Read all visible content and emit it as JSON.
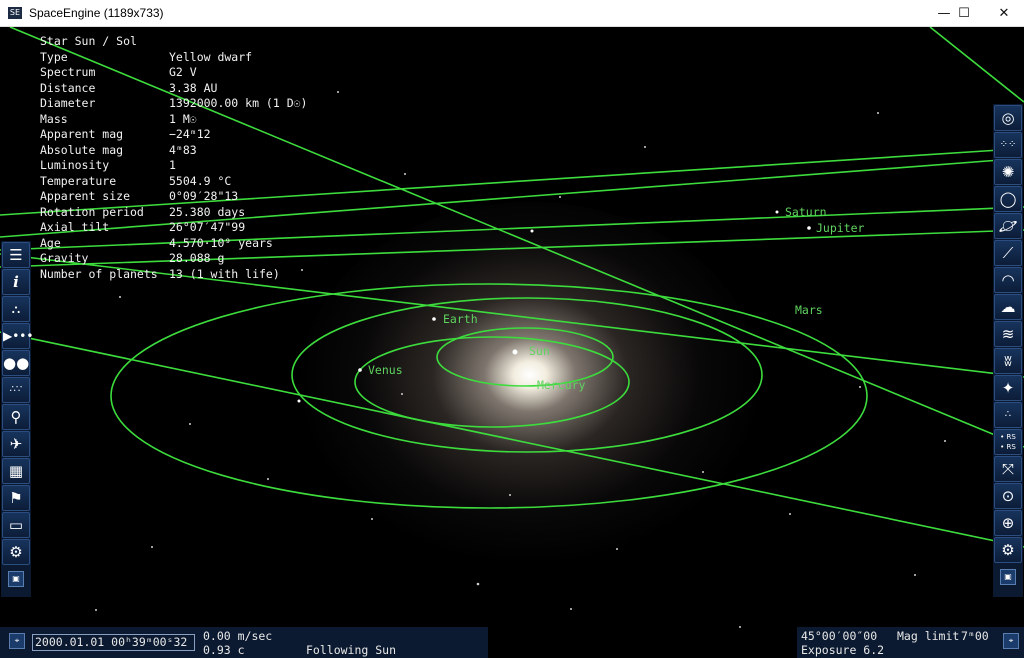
{
  "window": {
    "title": "SpaceEngine (1189x733)",
    "minimize": "—",
    "maximize": "☐",
    "close": "✕"
  },
  "info": {
    "rows": [
      {
        "key": "Star  Sun / Sol",
        "value": ""
      },
      {
        "key": "Type",
        "value": "Yellow dwarf"
      },
      {
        "key": "Spectrum",
        "value": "G2 V"
      },
      {
        "key": "Distance",
        "value": "3.38 AU"
      },
      {
        "key": "Diameter",
        "value": "1392000.00 km (1 D☉)"
      },
      {
        "key": "Mass",
        "value": "1 M☉"
      },
      {
        "key": "Apparent mag",
        "value": "−24ᵐ12"
      },
      {
        "key": "Absolute mag",
        "value": "4ᵐ83"
      },
      {
        "key": "Luminosity",
        "value": "1"
      },
      {
        "key": "Temperature",
        "value": "5504.9 °C"
      },
      {
        "key": "Apparent size",
        "value": "0°09′28\"13"
      },
      {
        "key": "Rotation period",
        "value": "25.380 days"
      },
      {
        "key": "Axial tilt",
        "value": "26°07′47\"99"
      },
      {
        "key": "Age",
        "value": "4.570·10⁹ years"
      },
      {
        "key": "Gravity",
        "value": "28.088 g"
      },
      {
        "key": "Number of planets",
        "value": "13 (1 with life)"
      }
    ]
  },
  "planets": {
    "sun": "Sun",
    "mercury": "Mercury",
    "venus": "Venus",
    "earth": "Earth",
    "mars": "Mars",
    "jupiter": "Jupiter",
    "saturn": "Saturn"
  },
  "colors": {
    "orbit": "#3ddc3d",
    "label": "#5fd35f",
    "toolbar": "#0b1a30",
    "background": "#000000"
  },
  "left_toolbar": [
    "menu-icon",
    "info-icon",
    "planetarium-icon",
    "ship-icon",
    "binoculars-icon",
    "star-field-icon",
    "search-icon",
    "rocket-icon",
    "calendar-icon",
    "flag-icon",
    "display-icon",
    "settings-icon"
  ],
  "right_toolbar": [
    "galaxies-icon",
    "clusters-icon",
    "nebulae-icon",
    "rings-icon",
    "planets-icon",
    "orbits-icon",
    "atmospheres-icon",
    "clouds-icon",
    "water-icon",
    "aurora-icon",
    "stars-icon",
    "points-icon",
    "rs-labels-icon",
    "fullscreen-icon",
    "target-icon",
    "globe-icon",
    "settings-icon"
  ],
  "rs_label": "RS",
  "status": {
    "date": "2000.01.01  00ʰ39ᵐ00ˢ32",
    "speed": "0.00  m/sec",
    "speed_c": "0.93  c",
    "following": "Following Sun",
    "fov": "45°00′00″00",
    "mag_limit_label": "Mag limit",
    "mag_limit_value": "7ᵐ00",
    "exposure": "Exposure 6.2"
  }
}
